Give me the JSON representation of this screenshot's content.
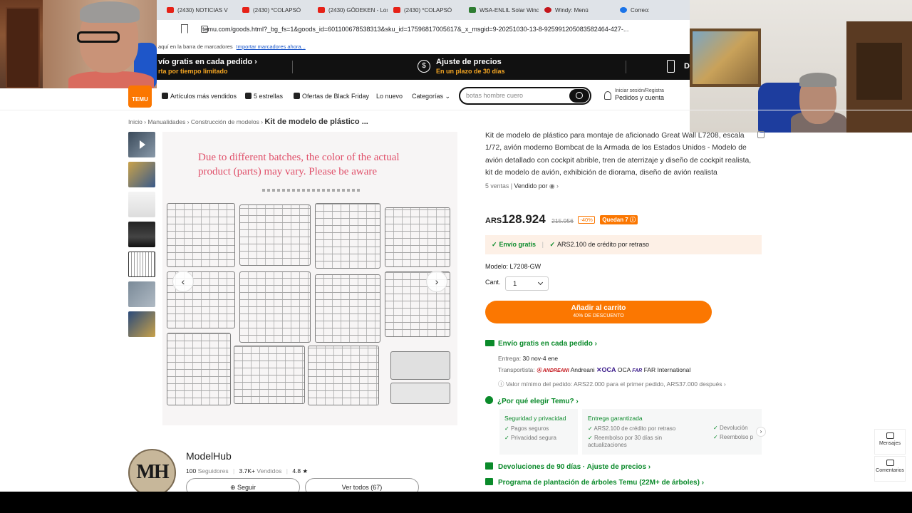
{
  "browser": {
    "tabs": [
      {
        "label": "(2430) NOTICIAS V",
        "icon": "youtube-icon"
      },
      {
        "label": "(2430) *COLAPSÓ",
        "icon": "youtube-icon"
      },
      {
        "label": "(2430) GÖDEKEN - Los",
        "icon": "youtube-icon"
      },
      {
        "label": "(2430) *COLAPSÓ",
        "icon": "youtube-icon"
      },
      {
        "label": "WSA-ENLIL Solar Wind",
        "icon": "globe-icon"
      },
      {
        "label": "Windy: Menú",
        "icon": "windy-icon"
      },
      {
        "label": "Correo:",
        "icon": "outlook-icon"
      }
    ],
    "url": "temu.com/goods.html?_bg_fs=1&goods_id=601100678538313&sku_id=17596817005617&_x_msgid=9-20251030-13-8-925991205083582464-427-...",
    "bookmarks_hint": "aquí en la barra de marcadores",
    "bookmarks_link": "Importar marcadores ahora..."
  },
  "promo": {
    "item1_title": "vío gratis en cada pedido ›",
    "item1_sub": "rta por tiempo limitado",
    "item2_title": "Ajuste de precios",
    "item2_sub": "En un plazo de 30 días",
    "item3_title": "D"
  },
  "header": {
    "logo": "TEMU",
    "nav": [
      "Artículos más vendidos",
      "5 estrellas",
      "Ofertas de Black Friday",
      "Lo nuevo",
      "Categorías ⌄"
    ],
    "search_placeholder": "botas hombre cuero",
    "account_line1": "Iniciar sesión/Registra",
    "account_line2": "Pedidos y cuenta"
  },
  "breadcrumb": [
    "Inicio",
    "Manualidades",
    "Construcción de modelos",
    "Kit de modelo de plástico ..."
  ],
  "gallery": {
    "notice": "Due to different batches, the color of the actual product (parts) may vary. Please be aware",
    "prev": "‹",
    "next": "›"
  },
  "product": {
    "title": "Kit de modelo de plástico para montaje de aficionado Great Wall L7208, escala 1/72, avión moderno Bombcat de la Armada de los Estados Unidos - Modelo de avión detallado con cockpit abrible, tren de aterrizaje y diseño de cockpit realista, kit de modelo de avión, exhibición de diorama, diseño de avión realista",
    "sales": "5 ventas",
    "seller_label": "Vendido por",
    "currency": "ARS",
    "price": "128.924",
    "old_price": "215.956",
    "discount": "-40%",
    "stock_badge": "Quedan 7",
    "free_shipping": "Envío gratis",
    "credit": "ARS2.100 de crédito por retraso",
    "model_label": "Modelo:",
    "model_value": "L7208-GW",
    "qty_label": "Cant.",
    "qty_value": "1",
    "cart_label": "Añadir al carrito",
    "cart_sub": "40% DE DESCUENTO"
  },
  "shipping": {
    "title": "Envío gratis en cada pedido",
    "delivery_label": "Entrega:",
    "delivery_value": "30 nov-4 ene",
    "carriers_label": "Transportista:",
    "carrier1_logo": "ANDREANI",
    "carrier1": "Andreani",
    "carrier2_logo": "OCA",
    "carrier2": "OCA",
    "carrier3_logo": "FAR",
    "carrier3": "FAR International",
    "min_order": "ⓘ Valor mínimo del pedido: ARS22.000 para el primer pedido, ARS37.000 después ›"
  },
  "why": {
    "title": "¿Por qué elegir Temu? ›",
    "col1_title": "Seguridad y privacidad",
    "col1_items": [
      "Pagos seguros",
      "Privacidad segura"
    ],
    "col2_title": "Entrega garantizada",
    "col2_items": [
      "ARS2.100 de crédito por retraso",
      "Reembolso por 30 días sin"
    ],
    "col2_extra": "actualizaciones",
    "col3_items": [
      "Devolución",
      "Reembolso p"
    ],
    "returns": "Devoluciones de 90 días · Ajuste de precios ›",
    "trees": "Programa de plantación de árboles Temu (22M+ de árboles) ›"
  },
  "seller": {
    "avatar_text": "MH",
    "name": "ModelHub",
    "followers": "100",
    "followers_label": "Seguidores",
    "sold": "3.7K+",
    "sold_label": "Vendidos",
    "rating": "4.8 ★",
    "follow": "⊕ Seguir",
    "view_all": "Ver todos (67)"
  },
  "side": {
    "messages": "Mensajes",
    "comments": "Comentarios"
  },
  "colors": {
    "brand_orange": "#fb7701",
    "success_green": "#0a8a2a",
    "promo_bg": "#111111"
  }
}
